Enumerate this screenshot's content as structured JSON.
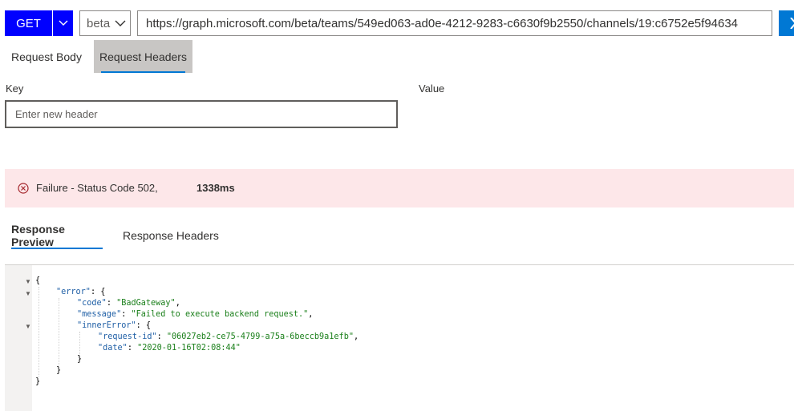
{
  "toolbar": {
    "method": "GET",
    "version": "beta",
    "url": "https://graph.microsoft.com/beta/teams/549ed063-ad0e-4212-9283-c6630f9b2550/channels/19:c6752e5f94634"
  },
  "request_tabs": {
    "body": "Request Body",
    "headers": "Request Headers"
  },
  "headers_editor": {
    "key_label": "Key",
    "value_label": "Value",
    "key_placeholder": "Enter new header"
  },
  "status": {
    "text": "Failure - Status Code 502,",
    "duration": "1338ms",
    "color": "#fde7e9"
  },
  "response_tabs": {
    "preview": "Response Preview",
    "headers": "Response Headers"
  },
  "response": {
    "error_key": "\"error\"",
    "code_key": "\"code\"",
    "code_value": "\"BadGateway\"",
    "message_key": "\"message\"",
    "message_value": "\"Failed to execute backend request.\"",
    "inner_key": "\"innerError\"",
    "request_id_key": "\"request-id\"",
    "request_id_value": "\"06027eb2-ce75-4799-a75a-6beccb9a1efb\"",
    "date_key": "\"date\"",
    "date_value": "\"2020-01-16T02:08:44\""
  },
  "colors": {
    "accent": "#0078d4",
    "method_button": "#0000ff"
  }
}
